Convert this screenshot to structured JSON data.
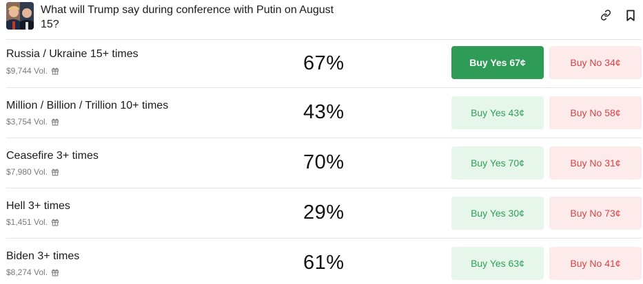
{
  "market": {
    "title": "What will Trump say during conference with Putin on August 15?"
  },
  "outcomes": [
    {
      "name": "Russia / Ukraine 15+ times",
      "volume": "$9,744 Vol.",
      "chance": "67%",
      "yes_label": "Buy Yes 67¢",
      "no_label": "Buy No 34¢",
      "yes_selected": true
    },
    {
      "name": "Million / Billion / Trillion 10+ times",
      "volume": "$3,754 Vol.",
      "chance": "43%",
      "yes_label": "Buy Yes 43¢",
      "no_label": "Buy No 58¢",
      "yes_selected": false
    },
    {
      "name": "Ceasefire 3+ times",
      "volume": "$7,980 Vol.",
      "chance": "70%",
      "yes_label": "Buy Yes 70¢",
      "no_label": "Buy No 31¢",
      "yes_selected": false
    },
    {
      "name": "Hell 3+ times",
      "volume": "$1,451 Vol.",
      "chance": "29%",
      "yes_label": "Buy Yes 30¢",
      "no_label": "Buy No 73¢",
      "yes_selected": false
    },
    {
      "name": "Biden 3+ times",
      "volume": "$8,274 Vol.",
      "chance": "61%",
      "yes_label": "Buy Yes 63¢",
      "no_label": "Buy No 41¢",
      "yes_selected": false
    }
  ],
  "icons": {
    "link": "link-icon",
    "bookmark": "bookmark-icon",
    "gift": "gift-icon"
  },
  "colors": {
    "yes_selected_bg": "#2e9b56",
    "yes_bg": "#e6f6ea",
    "yes_text": "#2f9e58",
    "no_bg": "#fdeaea",
    "no_text": "#d94343"
  }
}
